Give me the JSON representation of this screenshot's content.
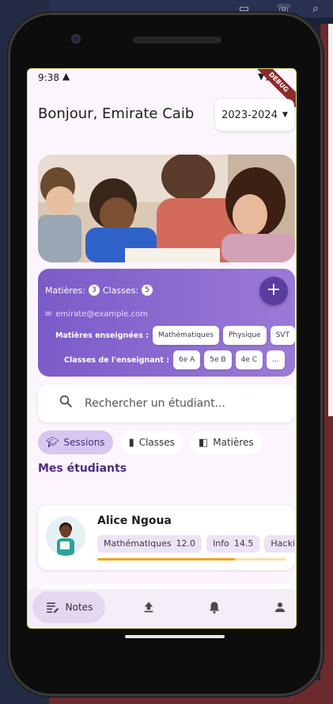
{
  "status_bar": {
    "time": "9:38"
  },
  "debug_banner": "DEBUG",
  "header": {
    "greeting": "Bonjour, Emirate Caib",
    "year_selector": "2023-2024"
  },
  "teacher_card": {
    "subjects_label": "Matières:",
    "subjects_count": "3",
    "classes_label": "Classes:",
    "classes_count": "5",
    "email": "emirate@example.com",
    "taught_subjects_label": "Matières enseignées :",
    "subjects": [
      "Mathématiques",
      "Physique",
      "SVT"
    ],
    "teacher_classes_label": "Classes de l'enseignant :",
    "classes": [
      "6e A",
      "5e B",
      "4e C",
      "..."
    ],
    "add_button": "+"
  },
  "search": {
    "placeholder": "Rechercher un étudiant..."
  },
  "tabs": [
    {
      "label": "Sessions",
      "icon": "graduation-cap-icon",
      "active": true
    },
    {
      "label": "Classes",
      "icon": "book-icon",
      "active": false
    },
    {
      "label": "Matières",
      "icon": "open-book-icon",
      "active": false
    }
  ],
  "section_title": "Mes étudiants",
  "students": [
    {
      "name": "Alice Ngoua",
      "grades": [
        {
          "subject": "Mathématiques",
          "grade": "12.0"
        },
        {
          "subject": "Info",
          "grade": "14.5"
        },
        {
          "subject": "Hacki",
          "grade": ""
        }
      ],
      "progress_fraction": 0.73
    }
  ],
  "bottom_nav": [
    {
      "label": "Notes",
      "icon": "notes-icon",
      "active": true
    },
    {
      "label": "",
      "icon": "upload-icon",
      "active": false
    },
    {
      "label": "",
      "icon": "bell-icon",
      "active": false
    },
    {
      "label": "",
      "icon": "person-icon",
      "active": false
    }
  ],
  "colors": {
    "accent": "#7b5bc8",
    "active_tab": "#d7c6ef",
    "progress": "#f5a313",
    "background": "#fcf5fd"
  }
}
